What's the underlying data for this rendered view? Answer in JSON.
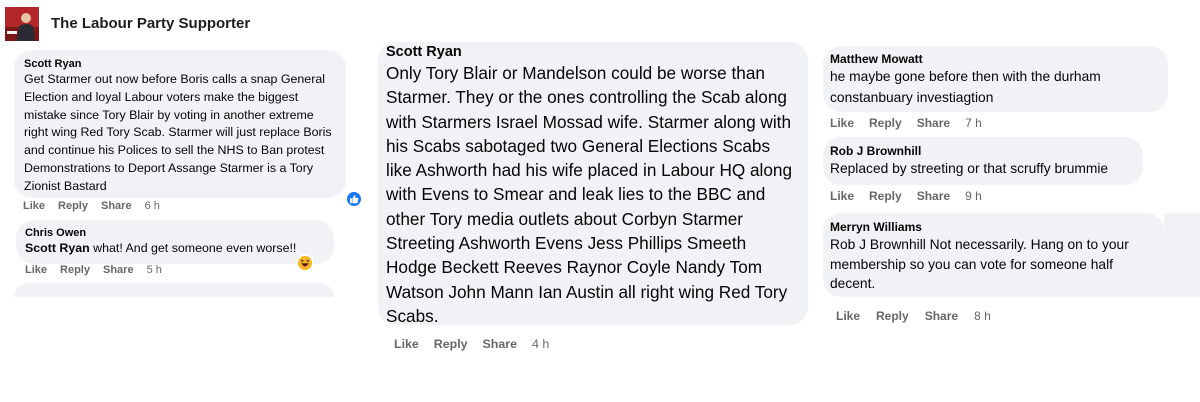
{
  "group": {
    "name": "The Labour Party Supporter",
    "avatar_icon": "group-avatar"
  },
  "comments": [
    {
      "author": "Scott Ryan",
      "text": "Get Starmer out now before Boris calls a snap General Election and loyal Labour voters make the biggest mistake since Tory Blair by voting in another extreme right wing Red Tory Scab. Starmer will just replace Boris and continue his Polices to sell the NHS to Ban protest Demonstrations to Deport Assange Starmer is a Tory Zionist Bastard",
      "actions": {
        "like": "Like",
        "reply": "Reply",
        "share": "Share",
        "time": "6 h"
      },
      "reaction": "like-icon"
    },
    {
      "author": "Chris Owen",
      "mention": "Scott Ryan",
      "text": " what! And get someone even worse!!",
      "actions": {
        "like": "Like",
        "reply": "Reply",
        "share": "Share",
        "time": "5 h"
      },
      "reaction": "haha-icon"
    },
    {
      "author": "Scott Ryan",
      "text": "Only Tory Blair or Mandelson could be worse than Starmer. They or the ones controlling the Scab along with Starmers Israel Mossad wife. Starmer along with his Scabs sabotaged two General Elections Scabs like Ashworth had his wife placed in Labour HQ along with Evens to Smear and leak lies to the BBC and other Tory media outlets about Corbyn Starmer Streeting Ashworth Evens Jess Phillips Smeeth Hodge Beckett Reeves Raynor Coyle Nandy Tom Watson John Mann Ian Austin all right wing Red Tory Scabs.",
      "actions": {
        "like": "Like",
        "reply": "Reply",
        "share": "Share",
        "time": "4 h"
      }
    },
    {
      "author": "Matthew Mowatt",
      "text": "he maybe gone before then with the durham constanbuary investiagtion",
      "actions": {
        "like": "Like",
        "reply": "Reply",
        "share": "Share",
        "time": "7 h"
      }
    },
    {
      "author": "Rob J Brownhill",
      "text": "Replaced by streeting or that scruffy brummie",
      "actions": {
        "like": "Like",
        "reply": "Reply",
        "share": "Share",
        "time": "9 h"
      }
    },
    {
      "author": "Merryn Williams",
      "text": "Rob J Brownhill Not necessarily. Hang on to your membership so you can vote for someone half decent.",
      "actions": {
        "like": "Like",
        "reply": "Reply",
        "share": "Share",
        "time": "8 h"
      }
    }
  ],
  "colors": {
    "bubble": "#f0f2f5",
    "action_text": "#65676b",
    "like_blue": "#1877f2",
    "haha_yellow": "#f7b928"
  }
}
